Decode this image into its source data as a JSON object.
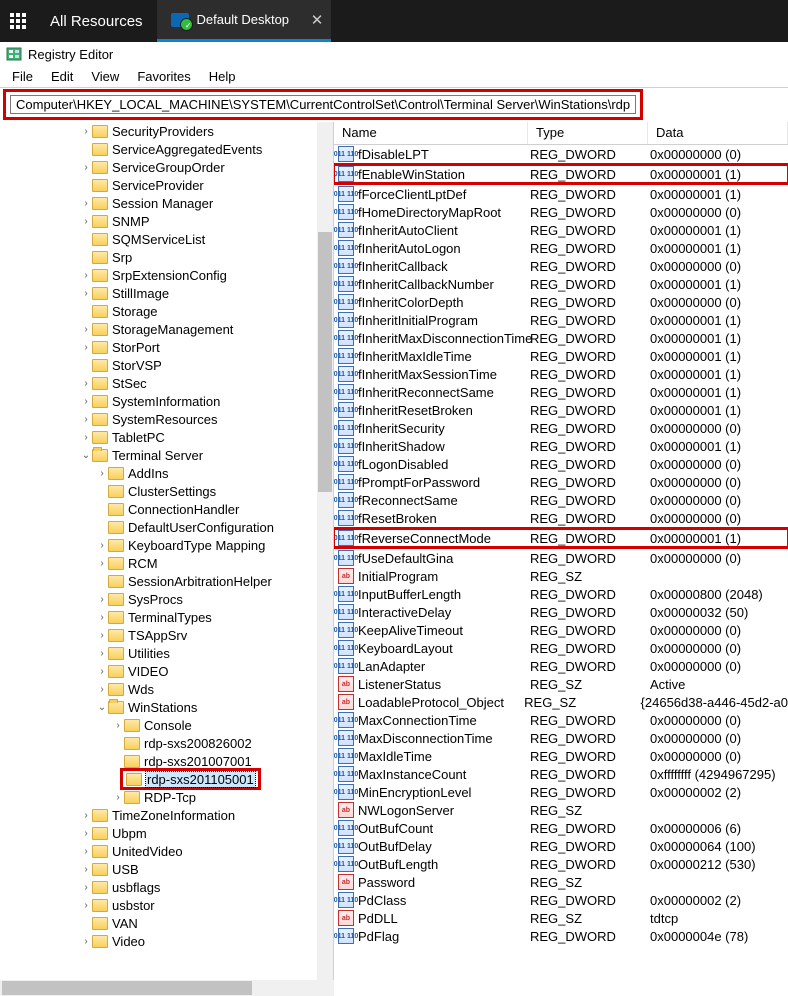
{
  "topbar": {
    "all_resources": "All Resources",
    "tab_label": "Default Desktop"
  },
  "app": {
    "title": "Registry Editor"
  },
  "menu": [
    "File",
    "Edit",
    "View",
    "Favorites",
    "Help"
  ],
  "address": "Computer\\HKEY_LOCAL_MACHINE\\SYSTEM\\CurrentControlSet\\Control\\Terminal Server\\WinStations\\rdp-sxs201105001",
  "tree": [
    {
      "d": 5,
      "e": ">",
      "l": "SecurityProviders"
    },
    {
      "d": 5,
      "e": "",
      "l": "ServiceAggregatedEvents"
    },
    {
      "d": 5,
      "e": ">",
      "l": "ServiceGroupOrder"
    },
    {
      "d": 5,
      "e": "",
      "l": "ServiceProvider"
    },
    {
      "d": 5,
      "e": ">",
      "l": "Session Manager"
    },
    {
      "d": 5,
      "e": ">",
      "l": "SNMP"
    },
    {
      "d": 5,
      "e": "",
      "l": "SQMServiceList"
    },
    {
      "d": 5,
      "e": "",
      "l": "Srp"
    },
    {
      "d": 5,
      "e": ">",
      "l": "SrpExtensionConfig"
    },
    {
      "d": 5,
      "e": ">",
      "l": "StillImage"
    },
    {
      "d": 5,
      "e": "",
      "l": "Storage"
    },
    {
      "d": 5,
      "e": ">",
      "l": "StorageManagement"
    },
    {
      "d": 5,
      "e": ">",
      "l": "StorPort"
    },
    {
      "d": 5,
      "e": "",
      "l": "StorVSP"
    },
    {
      "d": 5,
      "e": ">",
      "l": "StSec"
    },
    {
      "d": 5,
      "e": ">",
      "l": "SystemInformation"
    },
    {
      "d": 5,
      "e": ">",
      "l": "SystemResources"
    },
    {
      "d": 5,
      "e": ">",
      "l": "TabletPC"
    },
    {
      "d": 5,
      "e": "v",
      "l": "Terminal Server",
      "open": true
    },
    {
      "d": 6,
      "e": ">",
      "l": "AddIns"
    },
    {
      "d": 6,
      "e": "",
      "l": "ClusterSettings"
    },
    {
      "d": 6,
      "e": "",
      "l": "ConnectionHandler"
    },
    {
      "d": 6,
      "e": "",
      "l": "DefaultUserConfiguration"
    },
    {
      "d": 6,
      "e": ">",
      "l": "KeyboardType Mapping"
    },
    {
      "d": 6,
      "e": ">",
      "l": "RCM"
    },
    {
      "d": 6,
      "e": "",
      "l": "SessionArbitrationHelper"
    },
    {
      "d": 6,
      "e": ">",
      "l": "SysProcs"
    },
    {
      "d": 6,
      "e": ">",
      "l": "TerminalTypes"
    },
    {
      "d": 6,
      "e": ">",
      "l": "TSAppSrv"
    },
    {
      "d": 6,
      "e": ">",
      "l": "Utilities"
    },
    {
      "d": 6,
      "e": ">",
      "l": "VIDEO"
    },
    {
      "d": 6,
      "e": ">",
      "l": "Wds"
    },
    {
      "d": 6,
      "e": "v",
      "l": "WinStations",
      "open": true
    },
    {
      "d": 7,
      "e": ">",
      "l": "Console"
    },
    {
      "d": 7,
      "e": "",
      "l": "rdp-sxs200826002"
    },
    {
      "d": 7,
      "e": "",
      "l": "rdp-sxs201007001"
    },
    {
      "d": 7,
      "e": "",
      "l": "rdp-sxs201105001",
      "hl": true,
      "sel": true
    },
    {
      "d": 7,
      "e": ">",
      "l": "RDP-Tcp"
    },
    {
      "d": 5,
      "e": ">",
      "l": "TimeZoneInformation"
    },
    {
      "d": 5,
      "e": ">",
      "l": "Ubpm"
    },
    {
      "d": 5,
      "e": ">",
      "l": "UnitedVideo"
    },
    {
      "d": 5,
      "e": ">",
      "l": "USB"
    },
    {
      "d": 5,
      "e": ">",
      "l": "usbflags"
    },
    {
      "d": 5,
      "e": ">",
      "l": "usbstor"
    },
    {
      "d": 5,
      "e": "",
      "l": "VAN"
    },
    {
      "d": 5,
      "e": ">",
      "l": "Video"
    }
  ],
  "list_headers": {
    "name": "Name",
    "type": "Type",
    "data": "Data"
  },
  "values": [
    {
      "n": "fDisableLPT",
      "t": "REG_DWORD",
      "d": "0x00000000 (0)",
      "k": "num"
    },
    {
      "n": "fEnableWinStation",
      "t": "REG_DWORD",
      "d": "0x00000001 (1)",
      "k": "num",
      "hl": true
    },
    {
      "n": "fForceClientLptDef",
      "t": "REG_DWORD",
      "d": "0x00000001 (1)",
      "k": "num"
    },
    {
      "n": "fHomeDirectoryMapRoot",
      "t": "REG_DWORD",
      "d": "0x00000000 (0)",
      "k": "num"
    },
    {
      "n": "fInheritAutoClient",
      "t": "REG_DWORD",
      "d": "0x00000001 (1)",
      "k": "num"
    },
    {
      "n": "fInheritAutoLogon",
      "t": "REG_DWORD",
      "d": "0x00000001 (1)",
      "k": "num"
    },
    {
      "n": "fInheritCallback",
      "t": "REG_DWORD",
      "d": "0x00000000 (0)",
      "k": "num"
    },
    {
      "n": "fInheritCallbackNumber",
      "t": "REG_DWORD",
      "d": "0x00000001 (1)",
      "k": "num"
    },
    {
      "n": "fInheritColorDepth",
      "t": "REG_DWORD",
      "d": "0x00000000 (0)",
      "k": "num"
    },
    {
      "n": "fInheritInitialProgram",
      "t": "REG_DWORD",
      "d": "0x00000001 (1)",
      "k": "num"
    },
    {
      "n": "fInheritMaxDisconnectionTime",
      "t": "REG_DWORD",
      "d": "0x00000001 (1)",
      "k": "num"
    },
    {
      "n": "fInheritMaxIdleTime",
      "t": "REG_DWORD",
      "d": "0x00000001 (1)",
      "k": "num"
    },
    {
      "n": "fInheritMaxSessionTime",
      "t": "REG_DWORD",
      "d": "0x00000001 (1)",
      "k": "num"
    },
    {
      "n": "fInheritReconnectSame",
      "t": "REG_DWORD",
      "d": "0x00000001 (1)",
      "k": "num"
    },
    {
      "n": "fInheritResetBroken",
      "t": "REG_DWORD",
      "d": "0x00000001 (1)",
      "k": "num"
    },
    {
      "n": "fInheritSecurity",
      "t": "REG_DWORD",
      "d": "0x00000000 (0)",
      "k": "num"
    },
    {
      "n": "fInheritShadow",
      "t": "REG_DWORD",
      "d": "0x00000001 (1)",
      "k": "num"
    },
    {
      "n": "fLogonDisabled",
      "t": "REG_DWORD",
      "d": "0x00000000 (0)",
      "k": "num"
    },
    {
      "n": "fPromptForPassword",
      "t": "REG_DWORD",
      "d": "0x00000000 (0)",
      "k": "num"
    },
    {
      "n": "fReconnectSame",
      "t": "REG_DWORD",
      "d": "0x00000000 (0)",
      "k": "num"
    },
    {
      "n": "fResetBroken",
      "t": "REG_DWORD",
      "d": "0x00000000 (0)",
      "k": "num"
    },
    {
      "n": "fReverseConnectMode",
      "t": "REG_DWORD",
      "d": "0x00000001 (1)",
      "k": "num",
      "hl": true
    },
    {
      "n": "fUseDefaultGina",
      "t": "REG_DWORD",
      "d": "0x00000000 (0)",
      "k": "num"
    },
    {
      "n": "InitialProgram",
      "t": "REG_SZ",
      "d": "",
      "k": "str"
    },
    {
      "n": "InputBufferLength",
      "t": "REG_DWORD",
      "d": "0x00000800 (2048)",
      "k": "num"
    },
    {
      "n": "InteractiveDelay",
      "t": "REG_DWORD",
      "d": "0x00000032 (50)",
      "k": "num"
    },
    {
      "n": "KeepAliveTimeout",
      "t": "REG_DWORD",
      "d": "0x00000000 (0)",
      "k": "num"
    },
    {
      "n": "KeyboardLayout",
      "t": "REG_DWORD",
      "d": "0x00000000 (0)",
      "k": "num"
    },
    {
      "n": "LanAdapter",
      "t": "REG_DWORD",
      "d": "0x00000000 (0)",
      "k": "num"
    },
    {
      "n": "ListenerStatus",
      "t": "REG_SZ",
      "d": "Active",
      "k": "str"
    },
    {
      "n": "LoadableProtocol_Object",
      "t": "REG_SZ",
      "d": "{24656d38-a446-45d2-a0",
      "k": "str"
    },
    {
      "n": "MaxConnectionTime",
      "t": "REG_DWORD",
      "d": "0x00000000 (0)",
      "k": "num"
    },
    {
      "n": "MaxDisconnectionTime",
      "t": "REG_DWORD",
      "d": "0x00000000 (0)",
      "k": "num"
    },
    {
      "n": "MaxIdleTime",
      "t": "REG_DWORD",
      "d": "0x00000000 (0)",
      "k": "num"
    },
    {
      "n": "MaxInstanceCount",
      "t": "REG_DWORD",
      "d": "0xffffffff (4294967295)",
      "k": "num"
    },
    {
      "n": "MinEncryptionLevel",
      "t": "REG_DWORD",
      "d": "0x00000002 (2)",
      "k": "num"
    },
    {
      "n": "NWLogonServer",
      "t": "REG_SZ",
      "d": "",
      "k": "str"
    },
    {
      "n": "OutBufCount",
      "t": "REG_DWORD",
      "d": "0x00000006 (6)",
      "k": "num"
    },
    {
      "n": "OutBufDelay",
      "t": "REG_DWORD",
      "d": "0x00000064 (100)",
      "k": "num"
    },
    {
      "n": "OutBufLength",
      "t": "REG_DWORD",
      "d": "0x00000212 (530)",
      "k": "num"
    },
    {
      "n": "Password",
      "t": "REG_SZ",
      "d": "",
      "k": "str"
    },
    {
      "n": "PdClass",
      "t": "REG_DWORD",
      "d": "0x00000002 (2)",
      "k": "num"
    },
    {
      "n": "PdDLL",
      "t": "REG_SZ",
      "d": "tdtcp",
      "k": "str"
    },
    {
      "n": "PdFlag",
      "t": "REG_DWORD",
      "d": "0x0000004e (78)",
      "k": "num"
    }
  ]
}
